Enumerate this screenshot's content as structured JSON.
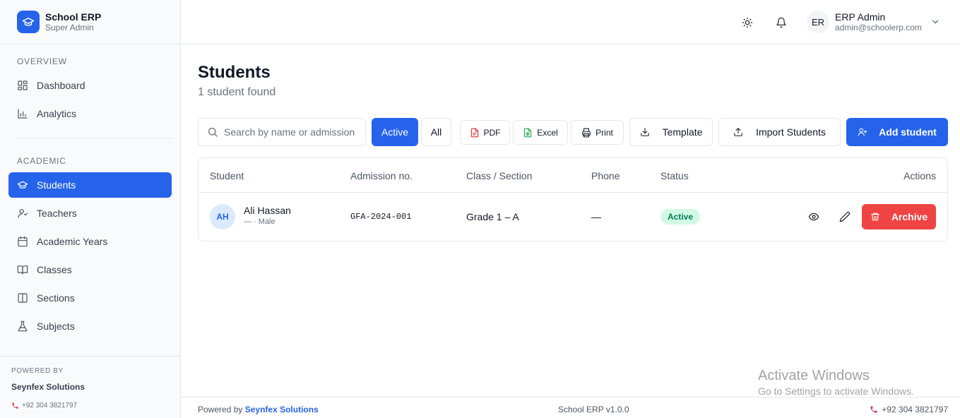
{
  "brand": {
    "title": "School ERP",
    "subtitle": "Super Admin"
  },
  "sidebar": {
    "overview_label": "OVERVIEW",
    "overview_items": [
      {
        "label": "Dashboard",
        "icon": "dashboard-icon"
      },
      {
        "label": "Analytics",
        "icon": "bar-chart-icon"
      }
    ],
    "academic_label": "ACADEMIC",
    "academic_items": [
      {
        "label": "Students",
        "icon": "graduation-cap-icon",
        "active": true
      },
      {
        "label": "Teachers",
        "icon": "user-icon"
      },
      {
        "label": "Academic Years",
        "icon": "calendar-icon"
      },
      {
        "label": "Classes",
        "icon": "book-open-icon"
      },
      {
        "label": "Sections",
        "icon": "columns-icon"
      },
      {
        "label": "Subjects",
        "icon": "flask-icon"
      }
    ],
    "powered_label": "POWERED BY",
    "powered_name": "Seynfex Solutions",
    "powered_phone": "+92 304 3821797"
  },
  "header": {
    "user_initials": "ER",
    "user_name": "ERP Admin",
    "user_email": "admin@schoolerp.com"
  },
  "main": {
    "title": "Students",
    "subtitle": "1 student found",
    "search_placeholder": "Search by name or admission",
    "filters": {
      "active": "Active",
      "all": "All"
    },
    "buttons": {
      "pdf": "PDF",
      "excel": "Excel",
      "print": "Print",
      "template": "Template",
      "import": "Import Students",
      "add": "Add student"
    }
  },
  "table": {
    "columns": [
      "Student",
      "Admission no.",
      "Class / Section",
      "Phone",
      "Status",
      "Actions"
    ],
    "rows": [
      {
        "initials": "AH",
        "name": "Ali Hassan",
        "meta": "— · Male",
        "admission_no": "GFA-2024-001",
        "class_section": "Grade 1 – A",
        "phone": "—",
        "status": "Active",
        "archive_label": "Archive"
      }
    ]
  },
  "watermark": {
    "title": "Activate Windows",
    "subtitle": "Go to Settings to activate Windows."
  },
  "footer": {
    "powered_prefix": "Powered by",
    "powered_link": "Seynfex Solutions",
    "version": "School ERP v1.0.0",
    "phone": "+92 304 3821797"
  },
  "colors": {
    "accent": "#2563eb",
    "danger": "#ef4444",
    "success_bg": "#d1fae5",
    "success_text": "#047857"
  }
}
